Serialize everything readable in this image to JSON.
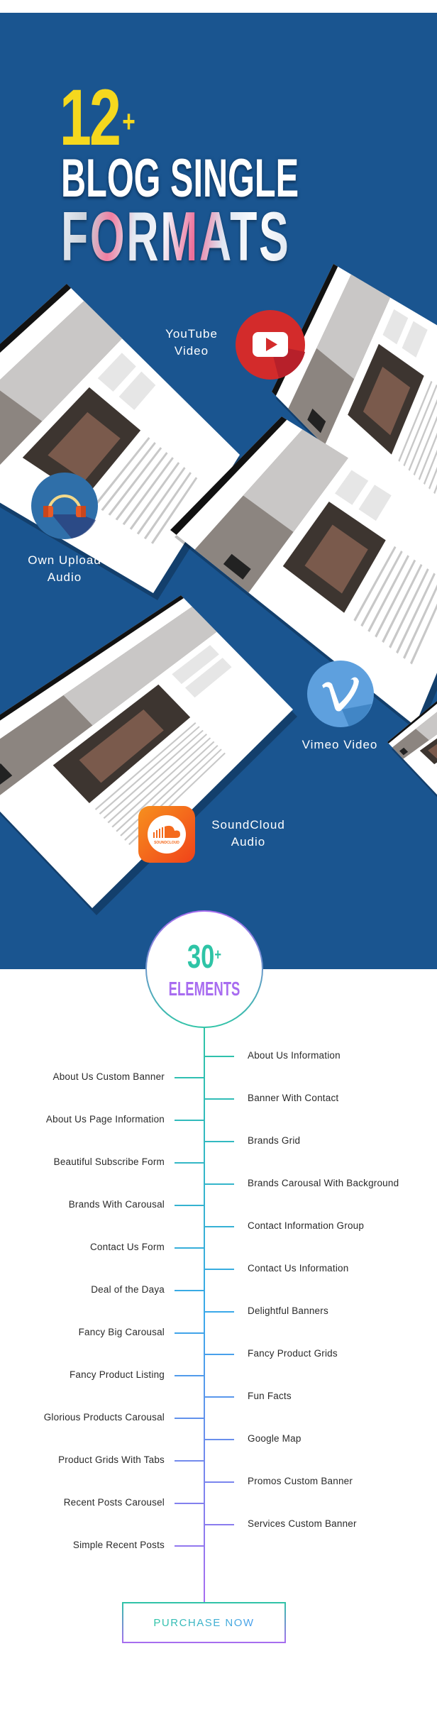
{
  "hero": {
    "count": "12",
    "count_suffix": "+",
    "title_line1": "BLOG SINGLE",
    "title_line2": "FORMATS",
    "formats": [
      {
        "label_line1": "YouTube",
        "label_line2": "Video",
        "icon": "youtube-icon",
        "color": "#d32b2b"
      },
      {
        "label_line1": "Own Upload",
        "label_line2": "Audio",
        "icon": "headphones-icon",
        "color": "#2f6fa9"
      },
      {
        "label_line1": "Vimeo Video",
        "label_line2": "",
        "icon": "vimeo-icon",
        "color": "#5ea0de"
      },
      {
        "label_line1": "SoundCloud",
        "label_line2": "Audio",
        "icon": "soundcloud-icon",
        "color": "#f46a1d"
      }
    ],
    "soundcloud_logo_text": "SOUNDCLOUD",
    "background_color": "#1a5590",
    "accent_color": "#f5d81e"
  },
  "elements": {
    "count": "30",
    "count_suffix": "+",
    "title": "ELEMENTS",
    "left_items": [
      "About Us Custom Banner",
      "About Us Page Information",
      "Beautiful Subscribe Form",
      "Brands With Carousal",
      "Contact Us Form",
      "Deal of the Daya",
      "Fancy Big Carousal",
      "Fancy Product Listing",
      "Glorious Products Carousal",
      "Product Grids With Tabs",
      "Recent Posts Carousel",
      "Simple Recent Posts"
    ],
    "right_items": [
      "About Us Information",
      "Banner With Contact",
      "Brands Grid",
      "Brands Carousal With Background",
      "Contact Information Group",
      "Contact Us Information",
      "Delightful Banners",
      "Fancy Product Grids",
      "Fun Facts",
      "Google Map",
      "Promos Custom Banner",
      "Services Custom Banner"
    ],
    "gradient_top": "#2ec4a6",
    "gradient_bottom": "#a86cf0"
  },
  "purchase": {
    "label": "PURCHASE NOW"
  }
}
